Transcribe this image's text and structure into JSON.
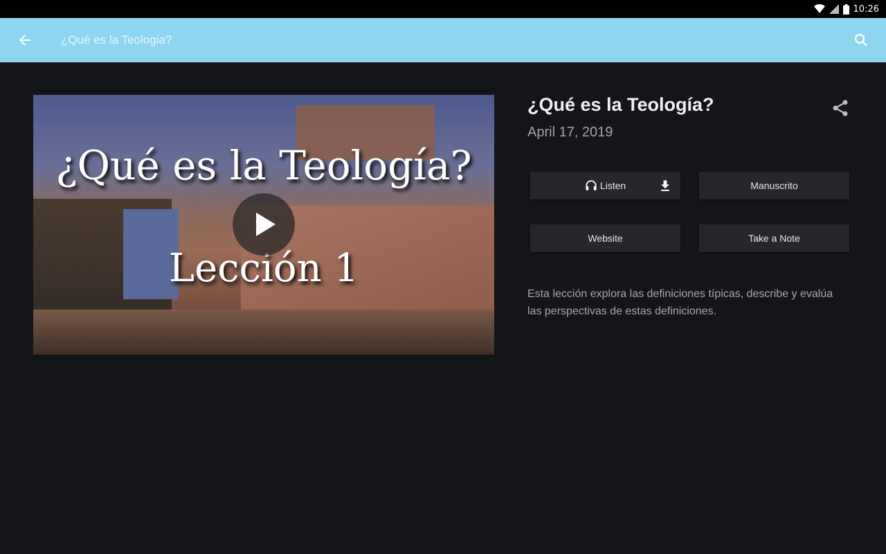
{
  "status_bar": {
    "time": "10:26",
    "icons": [
      "wifi-icon",
      "signal-icon",
      "battery-icon"
    ]
  },
  "app_bar": {
    "title": "¿Qué es la Teologia?",
    "back_icon": "arrow-left-icon",
    "search_icon": "search-icon",
    "color": "#8ed6f0"
  },
  "video": {
    "title_overlay": "¿Qué es la Teología?",
    "subtitle_overlay": "Lección 1",
    "play_icon": "play-icon"
  },
  "lesson": {
    "title": "¿Qué es la Teología?",
    "date": "April 17, 2019",
    "share_icon": "share-icon",
    "description": "Esta lección explora las definiciones típicas, describe y evalúa las perspectivas de estas definiciones."
  },
  "actions": {
    "listen": "Listen",
    "listen_icon": "headphones-icon",
    "download_icon": "download-icon",
    "manuscrito": "Manuscrito",
    "website": "Website",
    "take_note": "Take a Note"
  }
}
